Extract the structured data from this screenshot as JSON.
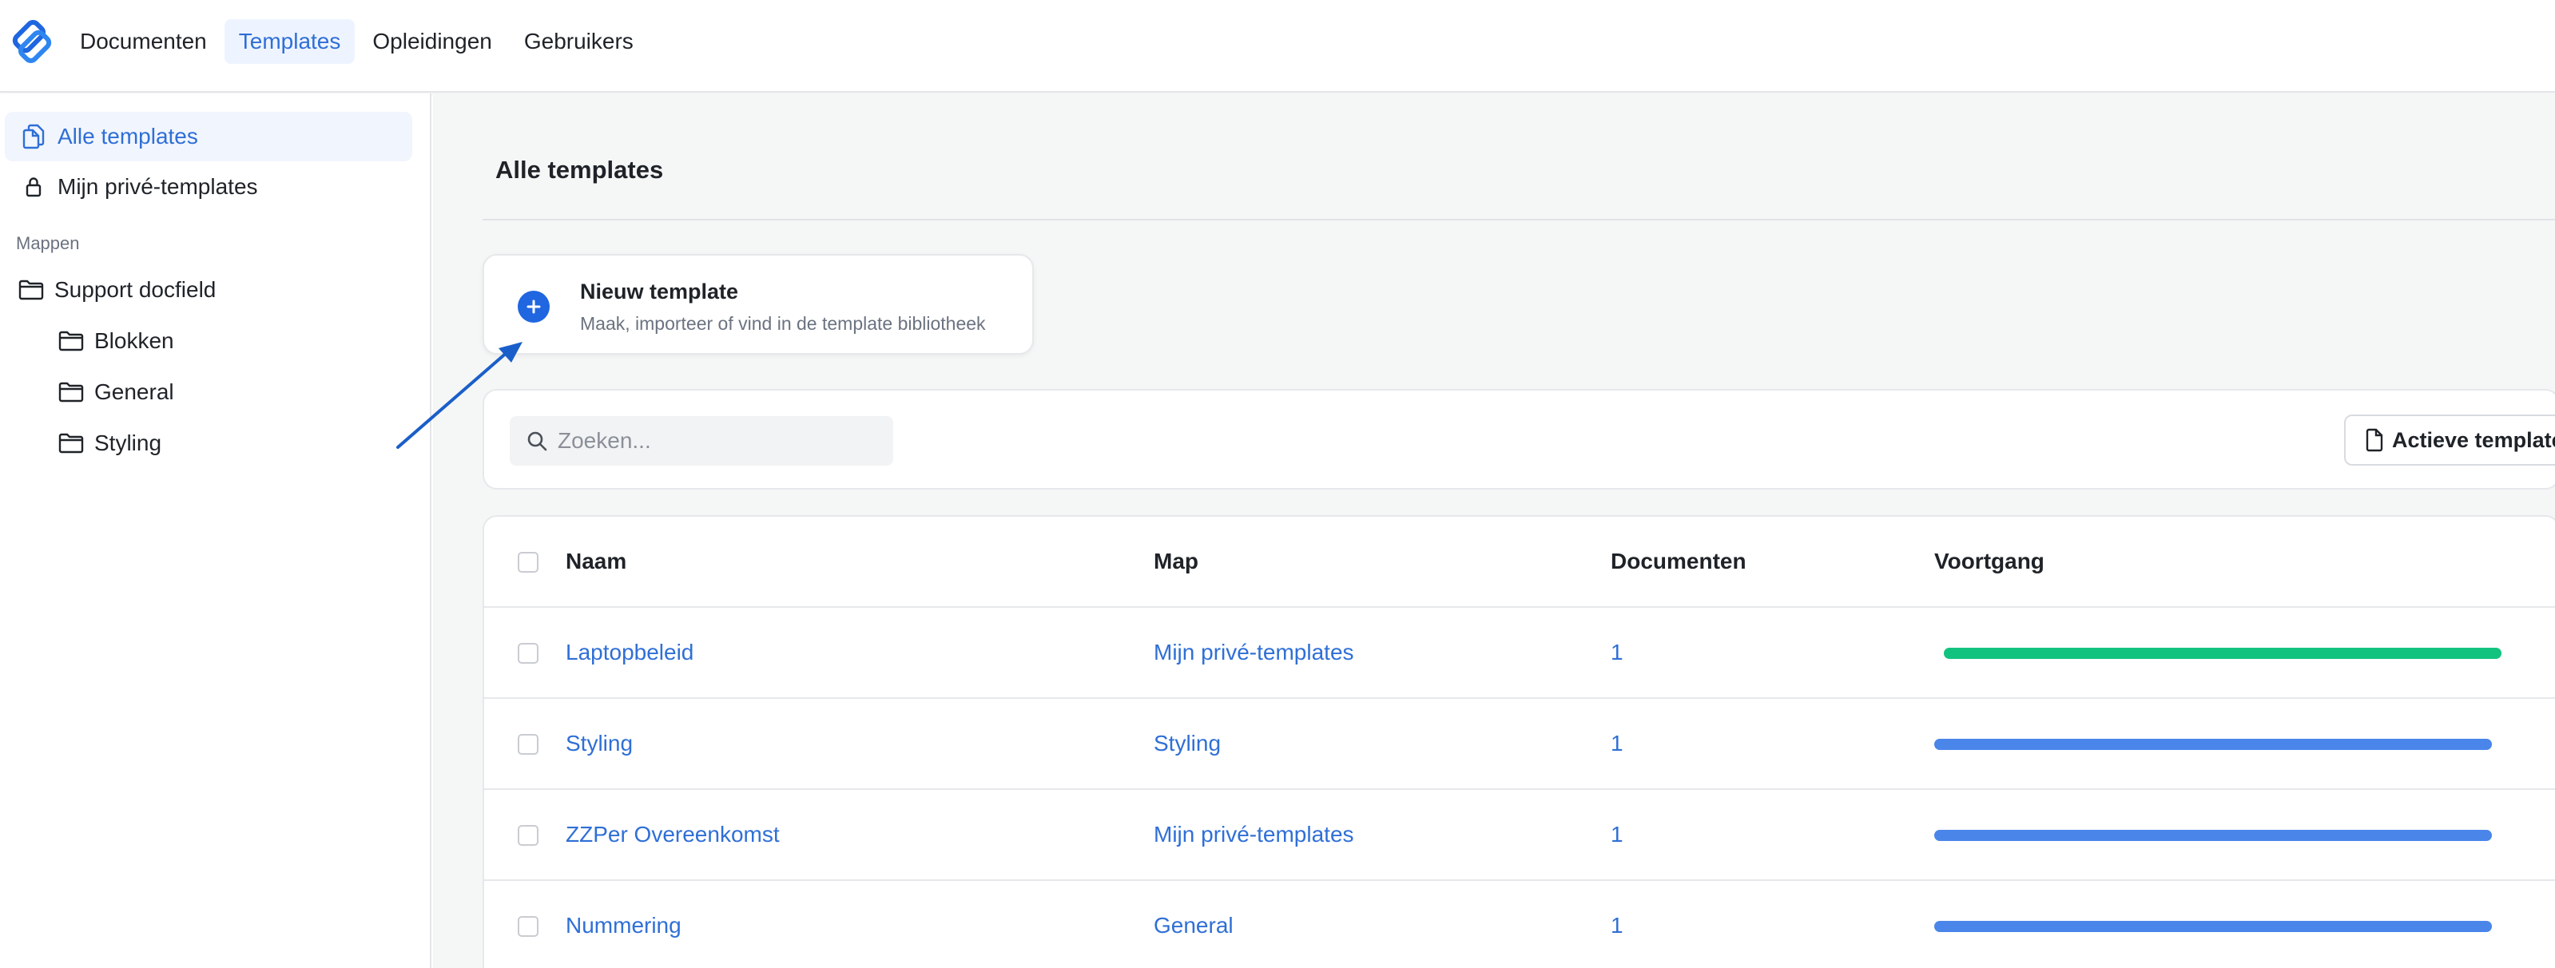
{
  "app": {
    "brand_color": "#1f66e0",
    "accent_color": "#2f6fd6",
    "nav": [
      {
        "label": "Documenten",
        "active": false
      },
      {
        "label": "Templates",
        "active": true
      },
      {
        "label": "Opleidingen",
        "active": false
      },
      {
        "label": "Gebruikers",
        "active": false
      }
    ]
  },
  "sidebar": {
    "items": [
      {
        "label": "Alle templates",
        "icon": "documents-icon",
        "active": true
      },
      {
        "label": "Mijn privé-templates",
        "icon": "lock-icon",
        "active": false
      }
    ],
    "section_label": "Mappen",
    "root_folder": "Support docfield",
    "subfolders": [
      "Blokken",
      "General",
      "Styling"
    ]
  },
  "main": {
    "title": "Alle templates",
    "new_template": {
      "title": "Nieuw template",
      "subtitle": "Maak, importeer of vind in de template bibliotheek"
    },
    "search": {
      "placeholder": "Zoeken...",
      "value": ""
    },
    "active_templates_button": "Actieve templates",
    "table": {
      "headers": [
        "Naam",
        "Map",
        "Documenten",
        "Voortgang"
      ],
      "rows": [
        {
          "name": "Laptopbeleid",
          "map": "Mijn privé-templates",
          "documents": "1",
          "progress": 1.0,
          "progress_color": "#12c37f"
        },
        {
          "name": "Styling",
          "map": "Styling",
          "documents": "1",
          "progress": 1.0,
          "progress_color": "#4a86ea"
        },
        {
          "name": "ZZPer Overeenkomst",
          "map": "Mijn privé-templates",
          "documents": "1",
          "progress": 1.0,
          "progress_color": "#4a86ea"
        },
        {
          "name": "Nummering",
          "map": "General",
          "documents": "1",
          "progress": 1.0,
          "progress_color": "#4a86ea"
        }
      ]
    }
  },
  "annotation": {
    "type": "arrow",
    "color": "#1a5fc9"
  }
}
